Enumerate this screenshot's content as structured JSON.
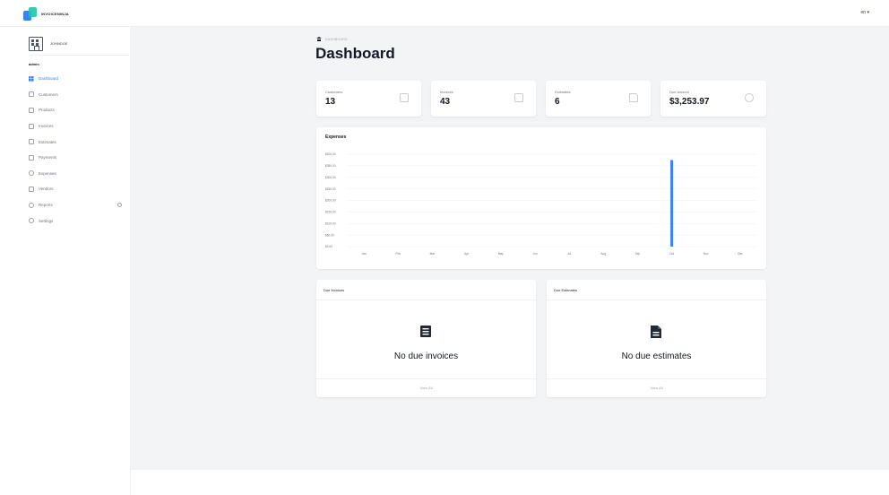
{
  "app": {
    "logo_text": "InvoiceNinja",
    "language": "en ▾"
  },
  "sidebar": {
    "company_name": "JOHNDOE",
    "section_label": "admin",
    "items": [
      {
        "label": "Dashboard",
        "icon": "grid-icon",
        "active": true
      },
      {
        "label": "Customers",
        "icon": "users-icon"
      },
      {
        "label": "Products",
        "icon": "box-icon"
      },
      {
        "label": "Invoices",
        "icon": "invoice-icon"
      },
      {
        "label": "Estimates",
        "icon": "document-icon"
      },
      {
        "label": "Payments",
        "icon": "card-icon"
      },
      {
        "label": "Expenses",
        "icon": "coin-icon"
      },
      {
        "label": "Vendors",
        "icon": "store-icon"
      },
      {
        "label": "Reports",
        "icon": "chart-icon"
      },
      {
        "label": "Settings",
        "icon": "gear-icon"
      }
    ]
  },
  "breadcrumb": {
    "label": "Dashboard"
  },
  "page": {
    "title": "Dashboard"
  },
  "stats": [
    {
      "label": "Customers",
      "value": "13",
      "icon": "users-icon"
    },
    {
      "label": "Invoices",
      "value": "43",
      "icon": "invoice-icon"
    },
    {
      "label": "Estimates",
      "value": "6",
      "icon": "document-icon"
    },
    {
      "label": "Due amount",
      "value": "$3,253.97",
      "icon": "currency-icon"
    }
  ],
  "chart_data": {
    "type": "bar",
    "title": "Expenses",
    "categories": [
      "Jan",
      "Feb",
      "Mar",
      "Apr",
      "May",
      "Jun",
      "Jul",
      "Aug",
      "Sep",
      "Oct",
      "Nov",
      "Dec"
    ],
    "values": [
      0,
      0,
      0,
      0,
      0,
      0,
      0,
      0,
      0,
      375,
      0,
      0
    ],
    "yticks": [
      "$400.00",
      "$350.00",
      "$300.00",
      "$250.00",
      "$200.00",
      "$150.00",
      "$100.00",
      "$50.00",
      "$0.00"
    ],
    "ylim": [
      0,
      400
    ],
    "grid": true,
    "color": "#3b82f6"
  },
  "due_invoices": {
    "title": "Due Invoices",
    "empty_text": "No due invoices",
    "link": "View All"
  },
  "due_estimates": {
    "title": "Due Estimates",
    "empty_text": "No due estimates",
    "link": "View All"
  }
}
